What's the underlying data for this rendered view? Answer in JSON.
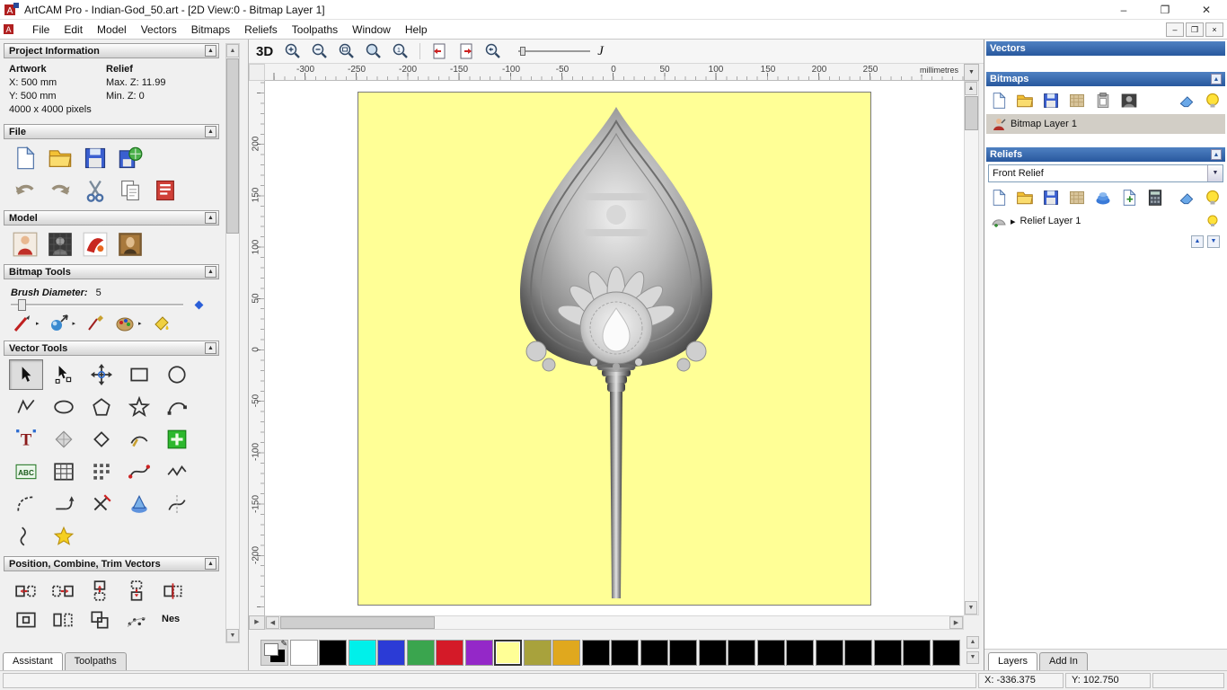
{
  "icons": {
    "minimize": "–",
    "maximize": "❐",
    "close": "✕",
    "mdi_minimize": "–",
    "mdi_restore": "❐",
    "mdi_close": "×",
    "collapse_up": "▲",
    "dropdown": "▼",
    "expand": "▸",
    "scroll_up": "▲",
    "scroll_down": "▼",
    "scroll_left": "◀",
    "scroll_right": "▶",
    "pencil": "✎",
    "layer_up": "▲",
    "layer_down": "▼",
    "slider_curve": "J"
  },
  "window": {
    "title": "ArtCAM Pro - Indian-God_50.art - [2D View:0 - Bitmap Layer 1]"
  },
  "menubar": {
    "items": [
      "File",
      "Edit",
      "Model",
      "Vectors",
      "Bitmaps",
      "Reliefs",
      "Toolpaths",
      "Window",
      "Help"
    ]
  },
  "assistant": {
    "tab_assistant": "Assistant",
    "tab_toolpaths": "Toolpaths",
    "project_information": {
      "title": "Project Information",
      "artwork_label": "Artwork",
      "artwork_x": "X: 500 mm",
      "artwork_y": "Y: 500 mm",
      "artwork_pixels": "4000 x 4000 pixels",
      "relief_label": "Relief",
      "relief_max_z": "Max. Z: 11.99",
      "relief_min_z": "Min. Z: 0"
    },
    "file_title": "File",
    "model_title": "Model",
    "bitmap_tools_title": "Bitmap Tools",
    "brush_diameter_label": "Brush Diameter:",
    "brush_diameter_value": "5",
    "vector_tools_title": "Vector Tools",
    "text_tool_glyph": "T",
    "abc_tool_glyph": "ABC",
    "nesting_tool_glyph": "Nes",
    "position_title": "Position, Combine, Trim Vectors"
  },
  "view_toolbar": {
    "threed_label": "3D"
  },
  "ruler": {
    "units": "millimetres",
    "h_labels": [
      "-300",
      "-250",
      "-200",
      "-150",
      "-100",
      "-50",
      "0",
      "50",
      "100",
      "150",
      "200",
      "250"
    ],
    "v_labels": [
      "200",
      "150",
      "100",
      "50",
      "0",
      "-50",
      "-100",
      "-150",
      "-200"
    ]
  },
  "canvas": {
    "background_color": "#ffff96"
  },
  "layers_panel": {
    "vectors_title": "Vectors",
    "bitmaps_title": "Bitmaps",
    "bitmap_layer_name": "Bitmap Layer 1",
    "reliefs_title": "Reliefs",
    "relief_set_value": "Front Relief",
    "relief_layer_name": "Relief Layer 1",
    "tab_layers": "Layers",
    "tab_addin": "Add In"
  },
  "palette": {
    "colors": [
      "#ffffff",
      "#000000",
      "#00f0ea",
      "#2b3bd6",
      "#3aa54e",
      "#d41a28",
      "#9428c8",
      "#ffff96",
      "#a8a23c",
      "#e0a81e",
      "#000000",
      "#000000",
      "#000000",
      "#000000",
      "#000000",
      "#000000",
      "#000000",
      "#000000",
      "#000000",
      "#000000",
      "#000000",
      "#000000",
      "#000000"
    ],
    "selected_index": 7
  },
  "status_bar": {
    "x_readout": "X: -336.375",
    "y_readout": "Y: 102.750"
  }
}
